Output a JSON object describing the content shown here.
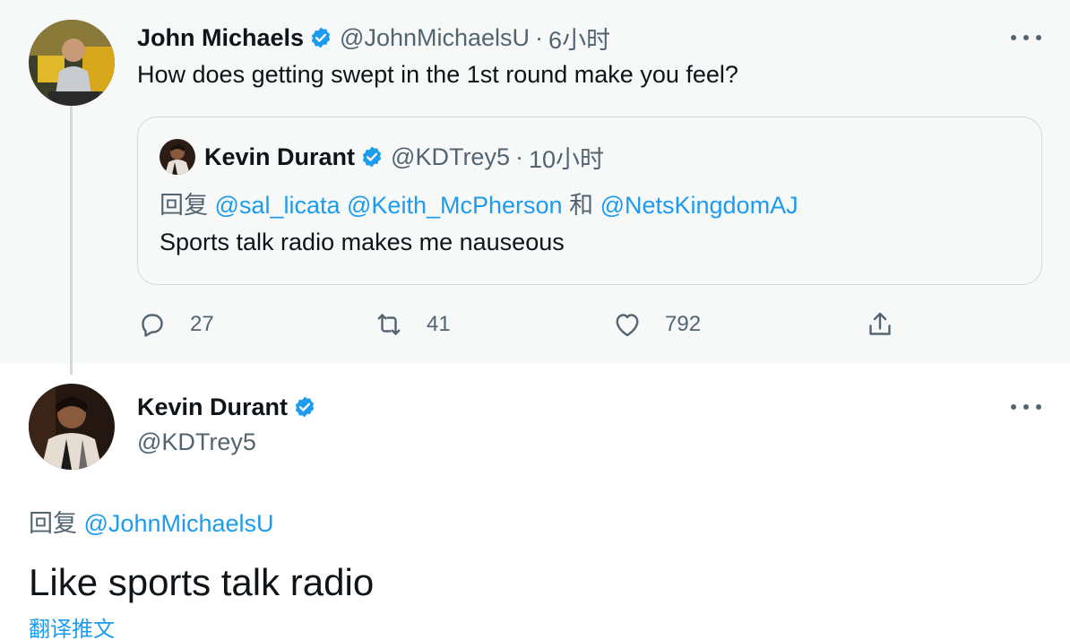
{
  "original_tweet": {
    "name": "John Michaels",
    "handle": "@JohnMichaelsU",
    "separator": "·",
    "time": "6小时",
    "text": "How does getting swept in the 1st round make you feel?",
    "quoted": {
      "name": "Kevin Durant",
      "handle": "@KDTrey5",
      "separator": "·",
      "time": "10小时",
      "reply_prefix": "回复",
      "mention_1": "@sal_licata",
      "mention_2": "@Keith_McPherson",
      "conjunction": "和",
      "mention_3": "@NetsKingdomAJ",
      "text": "Sports talk radio makes me nauseous"
    },
    "actions": {
      "reply_count": "27",
      "retweet_count": "41",
      "like_count": "792"
    }
  },
  "reply_tweet": {
    "name": "Kevin Durant",
    "handle": "@KDTrey5",
    "reply_prefix": "回复",
    "reply_to": "@JohnMichaelsU",
    "text": "Like sports talk radio",
    "translate_label": "翻译推文"
  },
  "icons": [
    "verified-badge-icon",
    "more-icon",
    "reply-icon",
    "retweet-icon",
    "like-icon",
    "share-icon"
  ],
  "colors": {
    "accent": "#1d9bf0",
    "secondary_text": "#536471",
    "border": "#cfd9de",
    "highlight_bg": "#f7f9f9"
  }
}
